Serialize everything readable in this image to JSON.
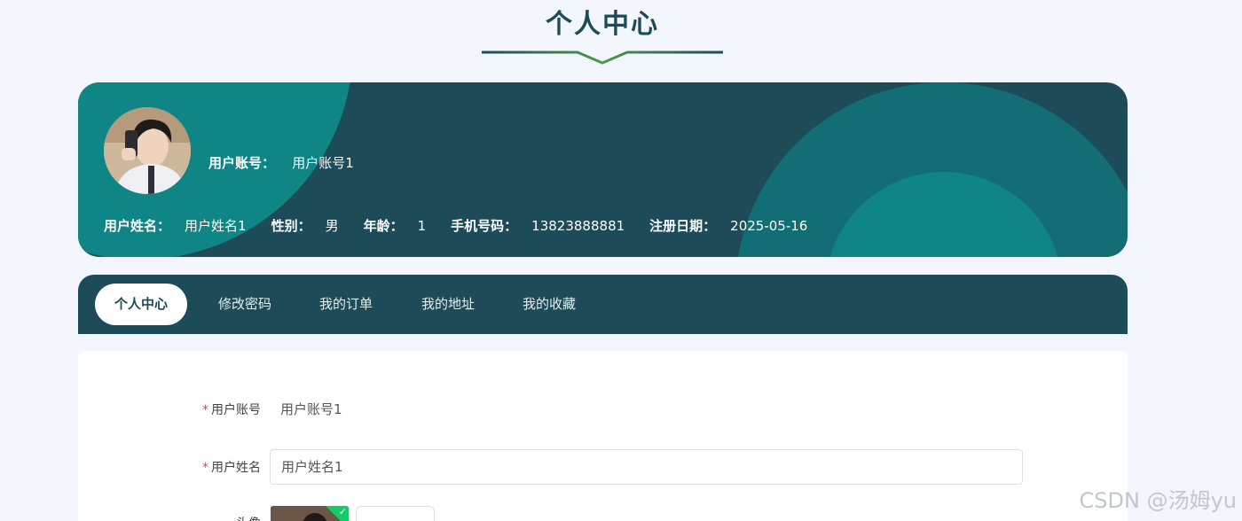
{
  "header": {
    "title": "个人中心"
  },
  "profile": {
    "account_label": "用户账号：",
    "account_value": "用户账号1",
    "name_label": "用户姓名：",
    "name_value": "用户姓名1",
    "gender_label": "性别：",
    "gender_value": "男",
    "age_label": "年龄：",
    "age_value": "1",
    "phone_label": "手机号码：",
    "phone_value": "13823888881",
    "register_label": "注册日期：",
    "register_value": "2025-05-16"
  },
  "tabs": [
    {
      "label": "个人中心",
      "active": true
    },
    {
      "label": "修改密码",
      "active": false
    },
    {
      "label": "我的订单",
      "active": false
    },
    {
      "label": "我的地址",
      "active": false
    },
    {
      "label": "我的收藏",
      "active": false
    }
  ],
  "form": {
    "account_label": "用户账号",
    "account_value": "用户账号1",
    "name_label": "用户姓名",
    "name_value": "用户姓名1",
    "avatar_label": "头像"
  },
  "watermark": "CSDN @汤姆yu",
  "colors": {
    "primary_dark": "#1d4b57",
    "accent_teal": "#0f8585",
    "accent_green": "#4f9a4c",
    "background": "#f3f7fd"
  }
}
